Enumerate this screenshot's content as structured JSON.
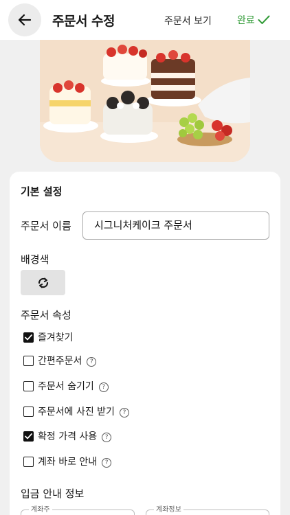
{
  "header": {
    "title": "주문서 수정",
    "view_link": "주문서 보기",
    "done_label": "완료"
  },
  "colors": {
    "accent_green": "#2f9a35",
    "checkbox_on": "#111111"
  },
  "icons": {
    "back": "back-arrow-icon",
    "done": "check-icon",
    "refresh": "refresh-icon",
    "help": "help-icon"
  },
  "basic": {
    "title": "기본 설정",
    "name_label": "주문서 이름",
    "name_value": "시그니처케이크 주문서",
    "bg_label": "배경색",
    "attr_label": "주문서 속성",
    "options": [
      {
        "label": "즐겨찾기",
        "checked": true,
        "help": false
      },
      {
        "label": "간편주문서",
        "checked": false,
        "help": true
      },
      {
        "label": "주문서 숨기기",
        "checked": false,
        "help": true
      },
      {
        "label": "주문서에 사진 받기",
        "checked": false,
        "help": true
      },
      {
        "label": "확정 가격 사용",
        "checked": true,
        "help": true
      },
      {
        "label": "계좌 바로 안내",
        "checked": false,
        "help": true
      }
    ]
  },
  "deposit": {
    "title": "입금 안내 정보",
    "holder_label": "계좌주",
    "info_label": "계좌정보"
  },
  "help_glyph": "?"
}
